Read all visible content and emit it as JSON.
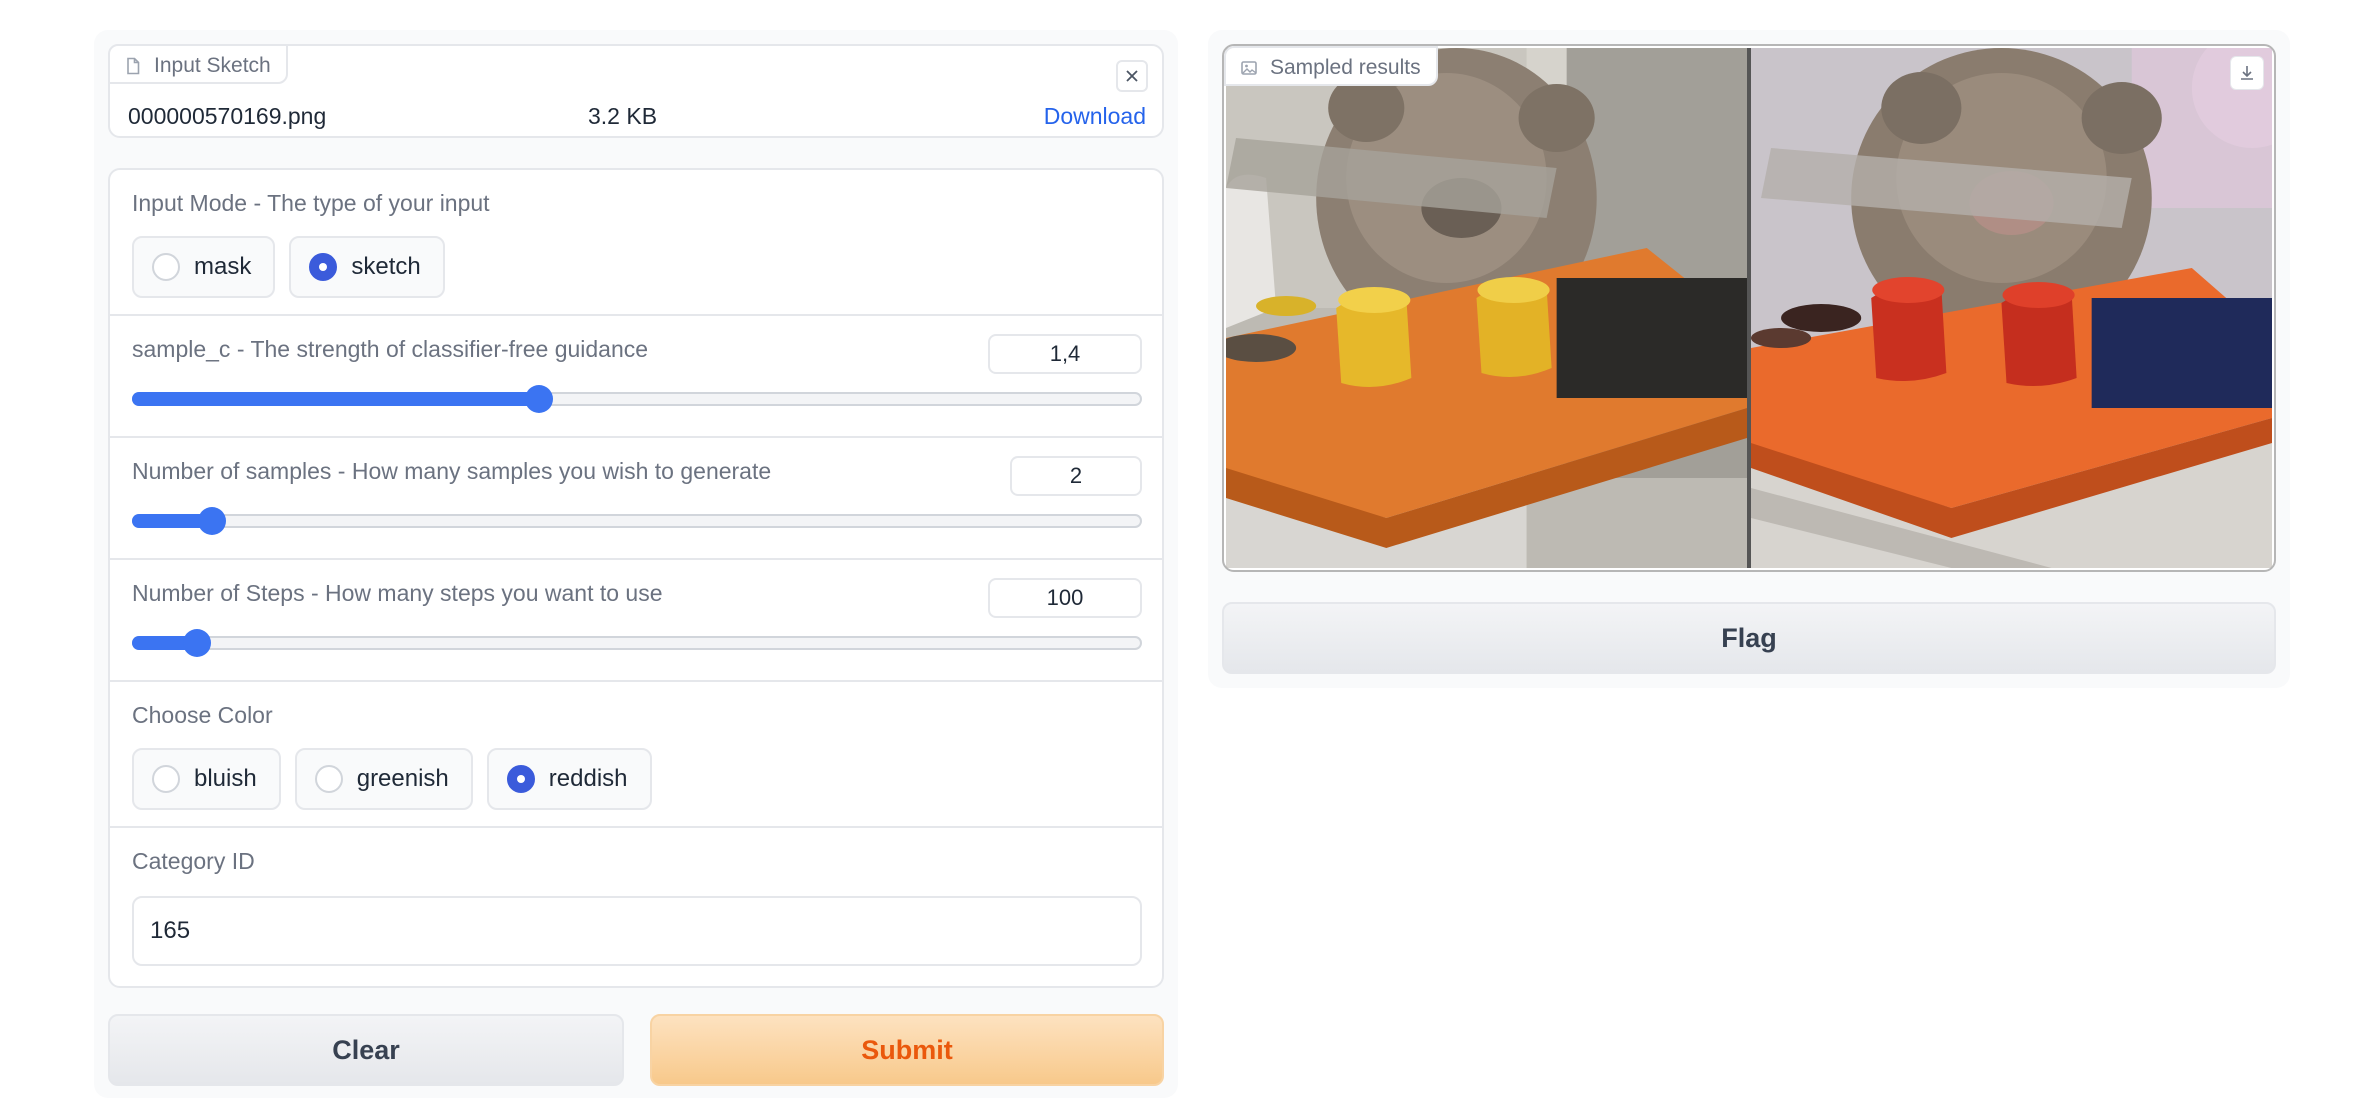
{
  "input_sketch": {
    "tab_label": "Input Sketch",
    "file_name": "000000570169.png",
    "file_size": "3.2 KB",
    "download_label": "Download"
  },
  "input_mode": {
    "label": "Input Mode - The type of your input",
    "options": [
      {
        "label": "mask",
        "checked": false
      },
      {
        "label": "sketch",
        "checked": true
      }
    ]
  },
  "sample_c": {
    "label": "sample_c - The strength of classifier-free guidance",
    "value": "1,4",
    "fraction": 0.403
  },
  "num_samples": {
    "label": "Number of samples - How many samples you wish to generate",
    "value": "2",
    "fraction": 0.078
  },
  "num_steps": {
    "label": "Number of Steps - How many steps you want to use",
    "value": "100",
    "fraction": 0.063
  },
  "color": {
    "label": "Choose Color",
    "options": [
      {
        "label": "bluish",
        "checked": false
      },
      {
        "label": "greenish",
        "checked": false
      },
      {
        "label": "reddish",
        "checked": true
      }
    ]
  },
  "category": {
    "label": "Category ID",
    "value": "165"
  },
  "buttons": {
    "clear": "Clear",
    "submit": "Submit",
    "flag": "Flag"
  },
  "results": {
    "tab_label": "Sampled results"
  }
}
